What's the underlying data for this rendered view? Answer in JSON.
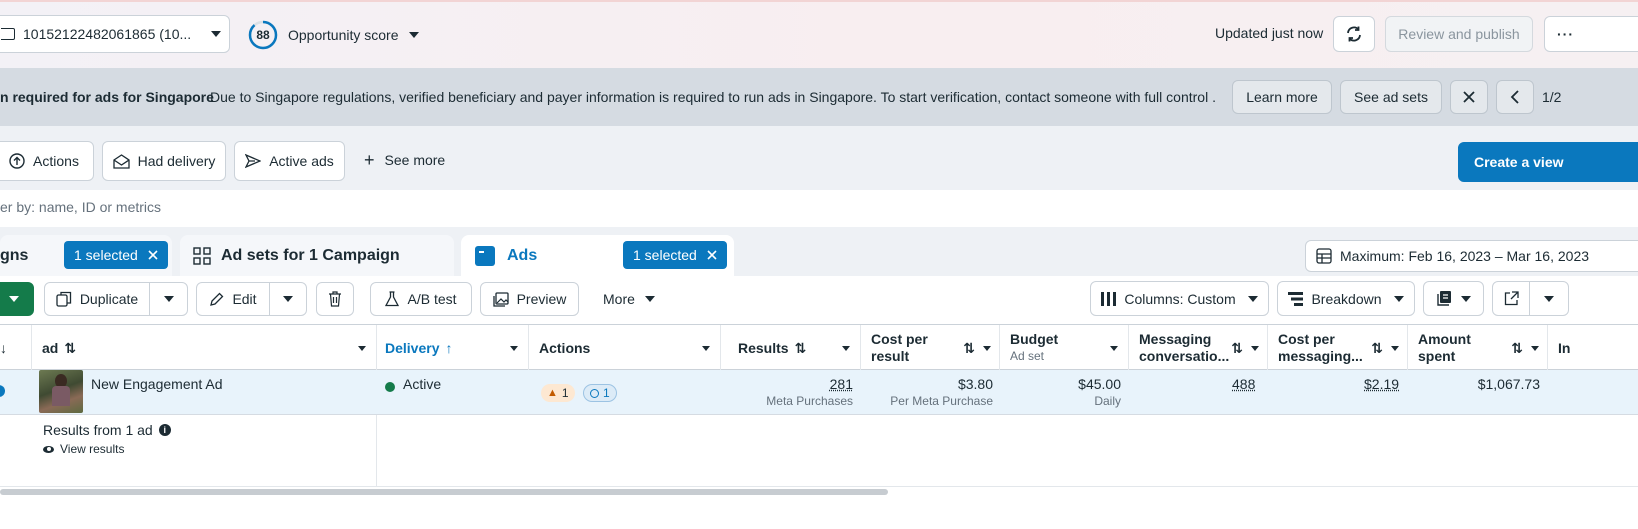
{
  "topbar": {
    "account": "10152122482061865 (10...",
    "score": "88",
    "opportunity": "Opportunity score",
    "updated": "Updated just now",
    "review": "Review and publish"
  },
  "banner": {
    "title": "n required for ads for Singapore",
    "message": "Due to Singapore regulations, verified beneficiary and payer information is required to run ads in Singapore. To start verification, contact someone with full control ...",
    "learn_more": "Learn more",
    "see_ad_sets": "See ad sets",
    "pager": "1/2"
  },
  "filters": {
    "actions": "Actions",
    "had_delivery": "Had delivery",
    "active_ads": "Active ads",
    "see_more": "See more",
    "create_view": "Create a view",
    "search_placeholder": "er by: name, ID or metrics"
  },
  "tabs": {
    "campaigns": "gns",
    "campaigns_selected": "1 selected",
    "adsets": "Ad sets for 1 Campaign",
    "ads": "Ads",
    "ads_selected": "1 selected",
    "date": "Maximum: Feb 16, 2023 – Mar 16, 2023"
  },
  "toolbar": {
    "duplicate": "Duplicate",
    "edit": "Edit",
    "ab_test": "A/B test",
    "preview": "Preview",
    "more": "More",
    "columns": "Columns: Custom",
    "breakdown": "Breakdown"
  },
  "columns": {
    "ad": "ad",
    "delivery": "Delivery",
    "actions": "Actions",
    "results": "Results",
    "cost_per_result_1": "Cost per",
    "cost_per_result_2": "result",
    "budget": "Budget",
    "budget_sub": "Ad set",
    "messaging_1": "Messaging",
    "messaging_2": "conversatio...",
    "cost_msg_1": "Cost per",
    "cost_msg_2": "messaging...",
    "amount_1": "Amount",
    "amount_2": "spent",
    "next": "In"
  },
  "row": {
    "name": "New Engagement Ad",
    "delivery": "Active",
    "warn_count": "1",
    "info_count": "1",
    "results": "281",
    "results_sub": "Meta Purchases",
    "cost": "$3.80",
    "cost_sub": "Per Meta Purchase",
    "budget": "$45.00",
    "budget_sub": "Daily",
    "messaging": "488",
    "cost_msg": "$2.19",
    "amount": "$1,067.73"
  },
  "footer": {
    "results_from": "Results from 1 ad",
    "view_results": "View results"
  },
  "colors": {
    "primary": "#0a78be",
    "green": "#147b4a",
    "active_dot": "#147b4a"
  }
}
